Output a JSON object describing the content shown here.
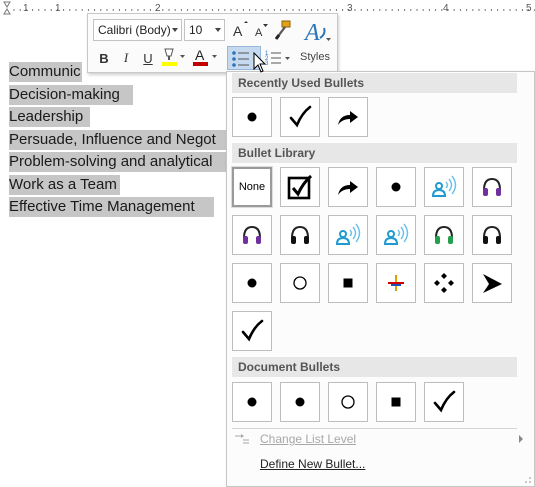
{
  "ruler": {
    "numbers": [
      "1",
      "1",
      "2",
      "3",
      "4",
      "5"
    ]
  },
  "document": {
    "lines": [
      "Communic",
      "Decision-making",
      "Leadership",
      "Persuade, Influence and Negot",
      "Problem-solving and analytical",
      "Work as a Team",
      "Effective Time Management"
    ]
  },
  "mini_toolbar": {
    "font_name": "Calibri (Body)",
    "font_size": "10",
    "bold": "B",
    "italic": "I",
    "underline": "U",
    "styles_label": "Styles",
    "highlight_color": "#ffff00",
    "font_color": "#c00000"
  },
  "gallery": {
    "recently_used_header": "Recently Used Bullets",
    "library_header": "Bullet Library",
    "document_header": "Document Bullets",
    "none_label": "None",
    "recent": [
      "filled-circle-bullet",
      "checkmark-bullet",
      "arrow-bullet"
    ],
    "library": [
      "none",
      "checkbox-bullet",
      "arrow-bullet",
      "filled-circle-bullet",
      "person-wifi-blue-bullet",
      "headphones-purple-bullet",
      "headphones-purple-bullet",
      "headphones-black-bullet",
      "person-wifi-blue-bullet",
      "person-wifi-blue-bullet",
      "headphones-green-bullet",
      "headphones-black-bullet",
      "filled-circle-bullet",
      "hollow-circle-bullet",
      "square-bullet",
      "star-color-bullet",
      "four-diamonds-bullet",
      "arrowhead-bullet",
      "checkmark-bullet"
    ],
    "document": [
      "filled-circle-bullet",
      "filled-circle-bullet",
      "hollow-circle-bullet",
      "square-bullet",
      "checkmark-bullet"
    ],
    "change_list_level": "Change List Level",
    "define_new_bullet": "Define New Bullet..."
  },
  "colors": {
    "selection": "#c6c6c6",
    "accent": "#2e75b6",
    "section_header_bg": "#e7e7e7"
  }
}
